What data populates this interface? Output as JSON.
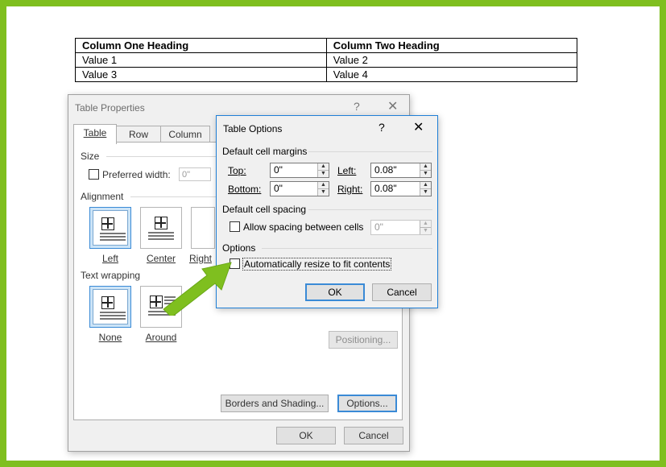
{
  "document": {
    "table": {
      "headers": [
        "Column One Heading",
        "Column Two Heading"
      ],
      "rows": [
        [
          "Value 1",
          "Value 2"
        ],
        [
          "Value 3",
          "Value 4"
        ]
      ]
    }
  },
  "table_properties": {
    "title": "Table Properties",
    "help": "?",
    "tabs": [
      "Table",
      "Row",
      "Column"
    ],
    "size_label": "Size",
    "preferred_width_label": "Preferred width:",
    "preferred_width_value": "0\"",
    "alignment_label": "Alignment",
    "alignment_options": [
      "Left",
      "Center",
      "Right"
    ],
    "text_wrapping_label": "Text wrapping",
    "wrapping_options": [
      "None",
      "Around"
    ],
    "positioning_button": "Positioning...",
    "borders_button": "Borders and Shading...",
    "options_button": "Options...",
    "ok": "OK",
    "cancel": "Cancel"
  },
  "table_options": {
    "title": "Table Options",
    "help": "?",
    "margins_label": "Default cell margins",
    "top_label": "Top:",
    "top_value": "0\"",
    "bottom_label": "Bottom:",
    "bottom_value": "0\"",
    "left_label": "Left:",
    "left_value": "0.08\"",
    "right_label": "Right:",
    "right_value": "0.08\"",
    "spacing_label": "Default cell spacing",
    "allow_spacing_label": "Allow spacing between cells",
    "spacing_value": "0\"",
    "options_label": "Options",
    "autoresize_label": "Automatically resize to fit contents",
    "ok": "OK",
    "cancel": "Cancel"
  },
  "colors": {
    "frame_border": "#7fbf1f",
    "arrow": "#7fbf1f",
    "accent_blue": "#3a8ad6"
  }
}
